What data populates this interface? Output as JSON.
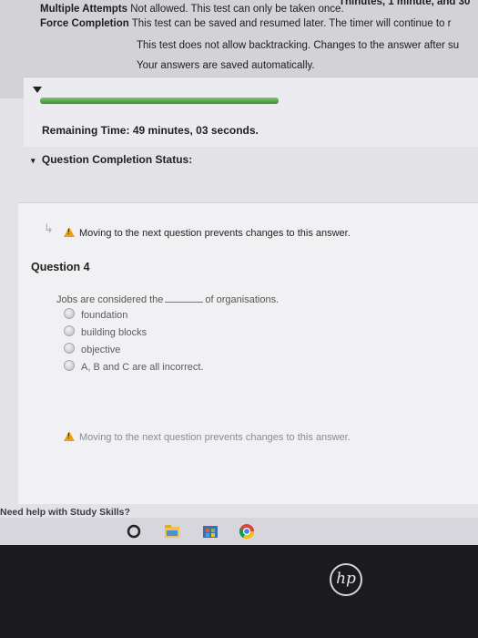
{
  "info": {
    "top_right_time": "Thinutes, 1 minute, and 30",
    "multiple_attempts_label": "Multiple Attempts",
    "multiple_attempts_text": "Not allowed. This test can only be taken once.",
    "force_completion_label": "Force Completion",
    "force_completion_text": "This test can be saved and resumed later. The timer will continue to r",
    "backtracking_text": "This test does not allow backtracking. Changes to the answer after su",
    "autosave_text": "Your answers are saved automatically."
  },
  "timer": {
    "progress_percent": 100,
    "remaining_label": "Remaining Time:",
    "remaining_value": "49 minutes, 03 seconds."
  },
  "status": {
    "label": "Question Completion Status:"
  },
  "question": {
    "warning_text": "Moving to the next question prevents changes to this answer.",
    "title": "Question 4",
    "text_before": "Jobs are considered the",
    "text_after": "of organisations.",
    "options": [
      "foundation",
      "building blocks",
      "objective",
      "A, B and C are all incorrect."
    ],
    "warning_text_bottom": "Moving to the next question prevents changes to this answer."
  },
  "footer": {
    "help_text": "Need help with Study Skills?"
  },
  "taskbar": {
    "icons": [
      "cortana-circle-icon",
      "file-explorer-icon",
      "store-icon",
      "chrome-icon"
    ]
  },
  "device": {
    "logo_text": "hp"
  },
  "colors": {
    "warning": "#e9a11d",
    "progress": "#4fa23c"
  }
}
